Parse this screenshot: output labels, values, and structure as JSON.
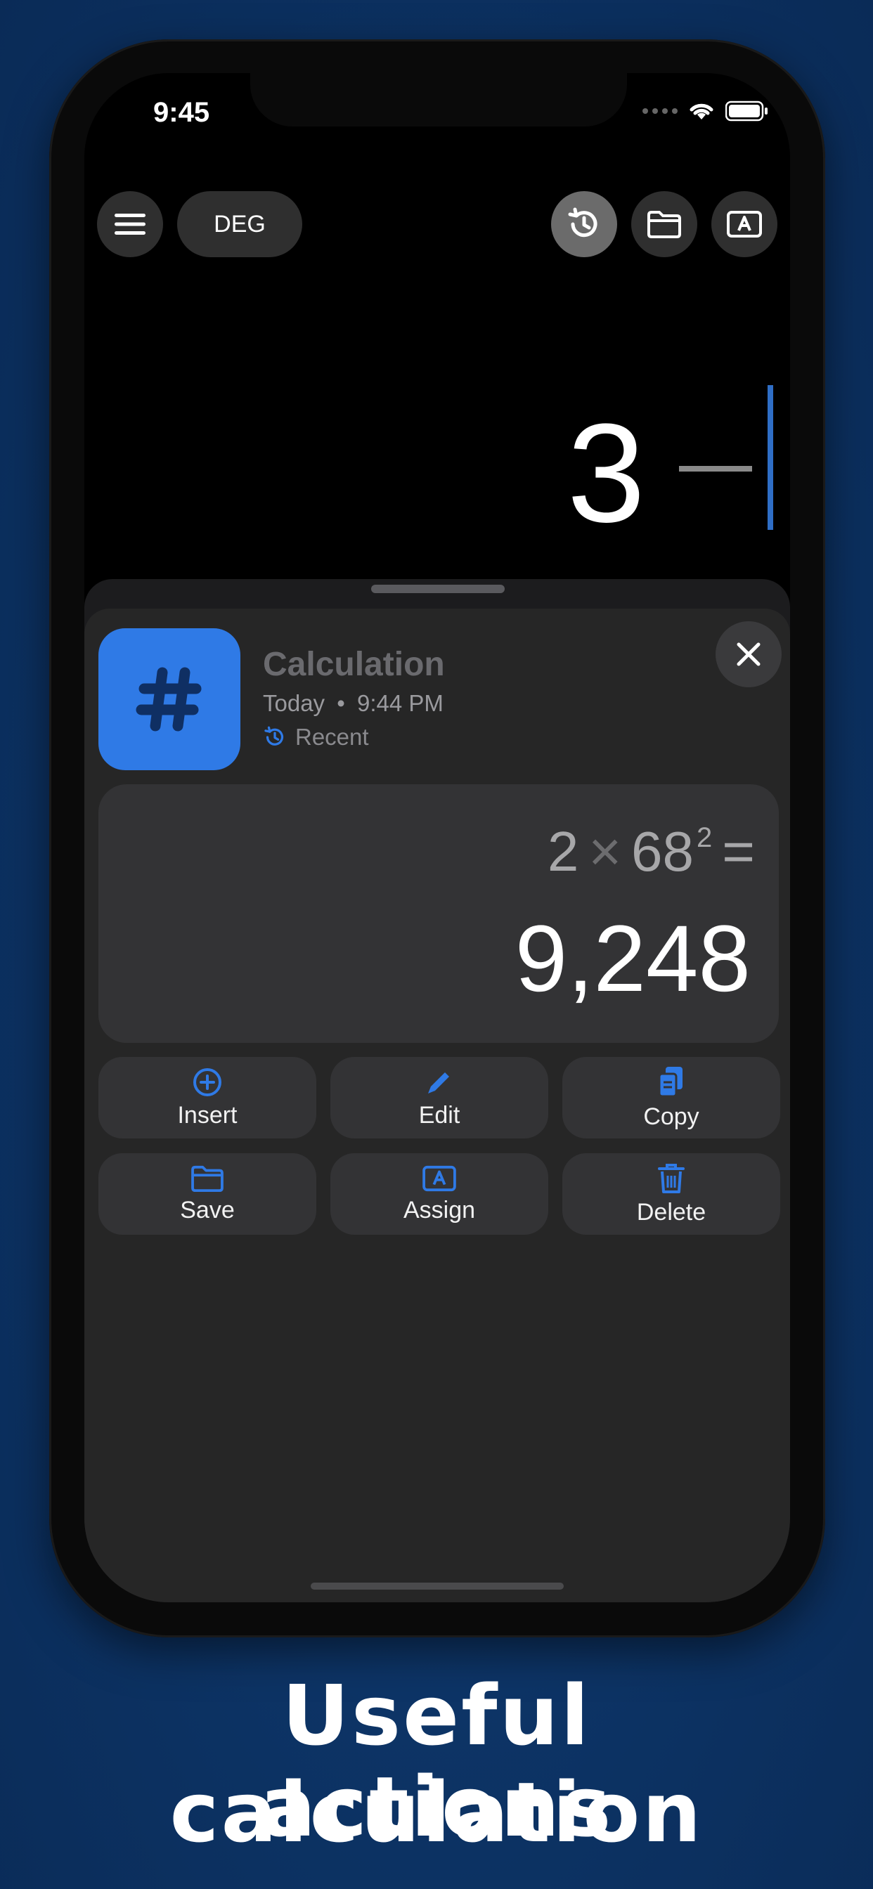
{
  "status": {
    "time": "9:45"
  },
  "toolbar": {
    "angle_mode": "DEG"
  },
  "display": {
    "expression": "3"
  },
  "entry": {
    "title": "Calculation",
    "date": "Today",
    "time": "9:44 PM",
    "tag": "Recent",
    "equation": {
      "a": "2",
      "op": "×",
      "b": "68",
      "exp": "2",
      "eq": "="
    },
    "result": "9,248"
  },
  "actions": [
    {
      "label": "Insert",
      "icon": "plus-circle-icon"
    },
    {
      "label": "Edit",
      "icon": "pencil-icon"
    },
    {
      "label": "Copy",
      "icon": "copy-icon"
    },
    {
      "label": "Save",
      "icon": "folder-icon"
    },
    {
      "label": "Assign",
      "icon": "variable-icon"
    },
    {
      "label": "Delete",
      "icon": "trash-icon"
    }
  ],
  "caption": {
    "line1": "Useful calculation",
    "line2": "actions"
  },
  "colors": {
    "accent": "#2f7ae6",
    "sheet": "#262626",
    "card": "#333335"
  }
}
